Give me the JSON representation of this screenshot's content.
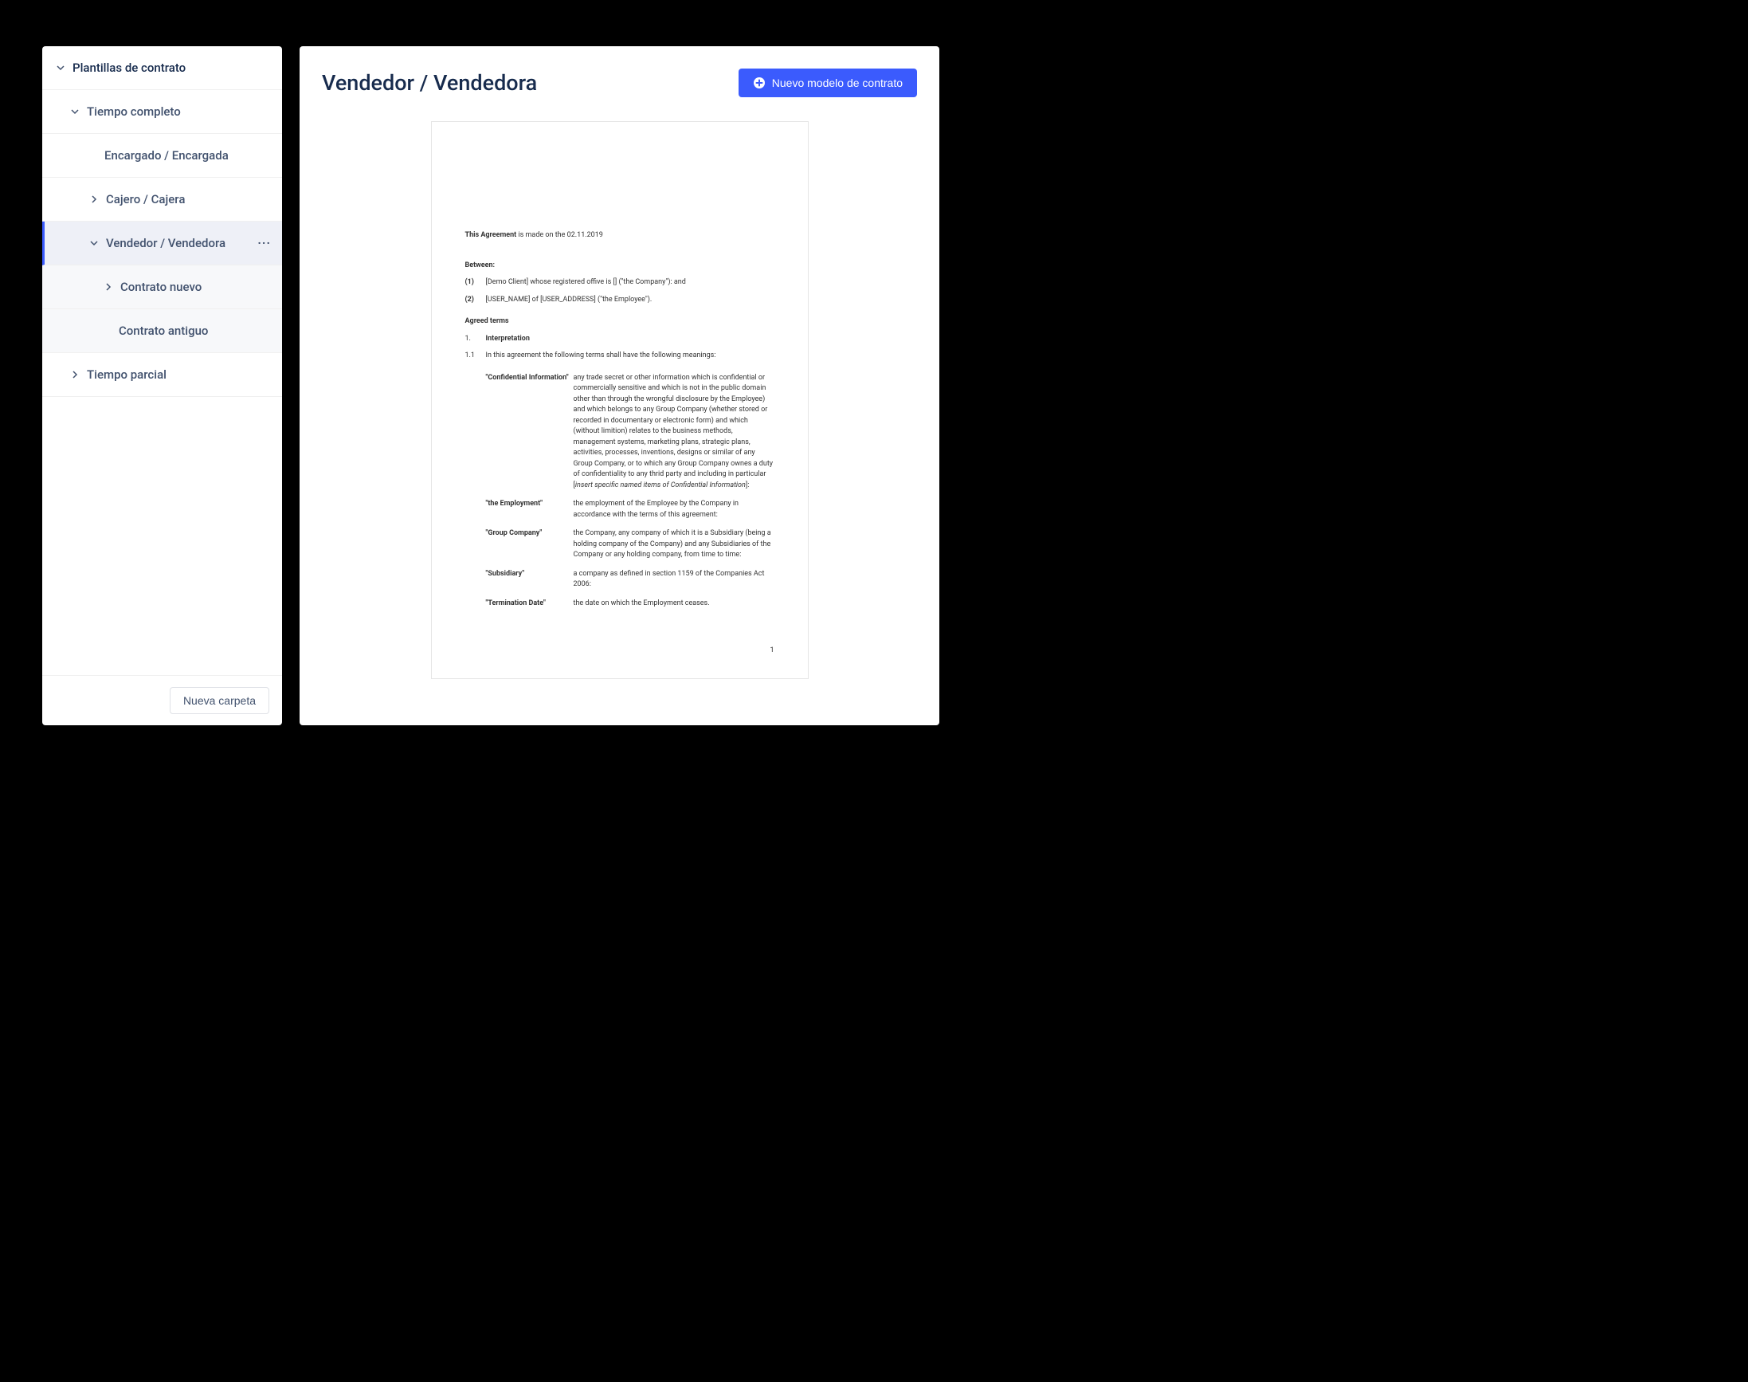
{
  "sidebar": {
    "root": "Plantillas de contrato",
    "group_fulltime": "Tiempo completo",
    "item_encargado": "Encargado / Encargada",
    "item_cajero": "Cajero / Cajera",
    "item_vendedor": "Vendedor / Vendedora",
    "item_contrato_nuevo": "Contrato nuevo",
    "item_contrato_antiguo": "Contrato antiguo",
    "group_parttime": "Tiempo parcial",
    "new_folder_btn": "Nueva carpeta"
  },
  "main": {
    "title": "Vendedor / Vendedora",
    "new_template_btn": "Nuevo modelo de contrato"
  },
  "doc": {
    "agreement_bold": "This Agreement",
    "agreement_text": " is made on the  02.11.2019",
    "between_label": "Between:",
    "party1_num": "(1)",
    "party1_text": "[Demo Client] whose registered offive is [] (\"the Company\"): and",
    "party2_num": "(2)",
    "party2_text": "[USER_NAME] of [USER_ADDRESS] (\"the Employee\").",
    "agreed_terms_label": "Agreed terms",
    "sec1_num": "1.",
    "sec1_title": "Interpretation",
    "sec11_num": "1.1",
    "sec11_text": "In this agreement the following terms shall have the following meanings:",
    "def1_term": "\"Confidential Information\"",
    "def1_body": "any trade secret or other information which is confidential or commercially sensitive and which is not in the public domain other than through the wrongful disclosure by the Employee) and which belongs to any Group Company (whether stored or recorded in documentary or electronic form) and which (without limition) relates to the business methods, management systems, marketing plans, strategic plans, activities, processes, inventions, designs or similar of any Group Company, or to which any Group Company ownes a duty of confidentiality to any thrid party and including  in particular [",
    "def1_body_italic": "insert specific named items of Confidential Information",
    "def1_body_end": "]:",
    "def2_term": "\"the Employment\"",
    "def2_body": "the employment of the Employee by the Company in accordance with the terms of this agreement:",
    "def3_term": "\"Group Company\"",
    "def3_body": "the Company, any company of which it is a Subsidiary (being a holding company of the Company) and any Subsidiaries of the Company or any holding company, from time to time:",
    "def4_term": "\"Subsidiary\"",
    "def4_body": "a company as defined in section 1159 of the Companies Act 2006:",
    "def5_term": "\"Termination Date\"",
    "def5_body": "the date on which the Employment ceases.",
    "page_number": "1"
  }
}
